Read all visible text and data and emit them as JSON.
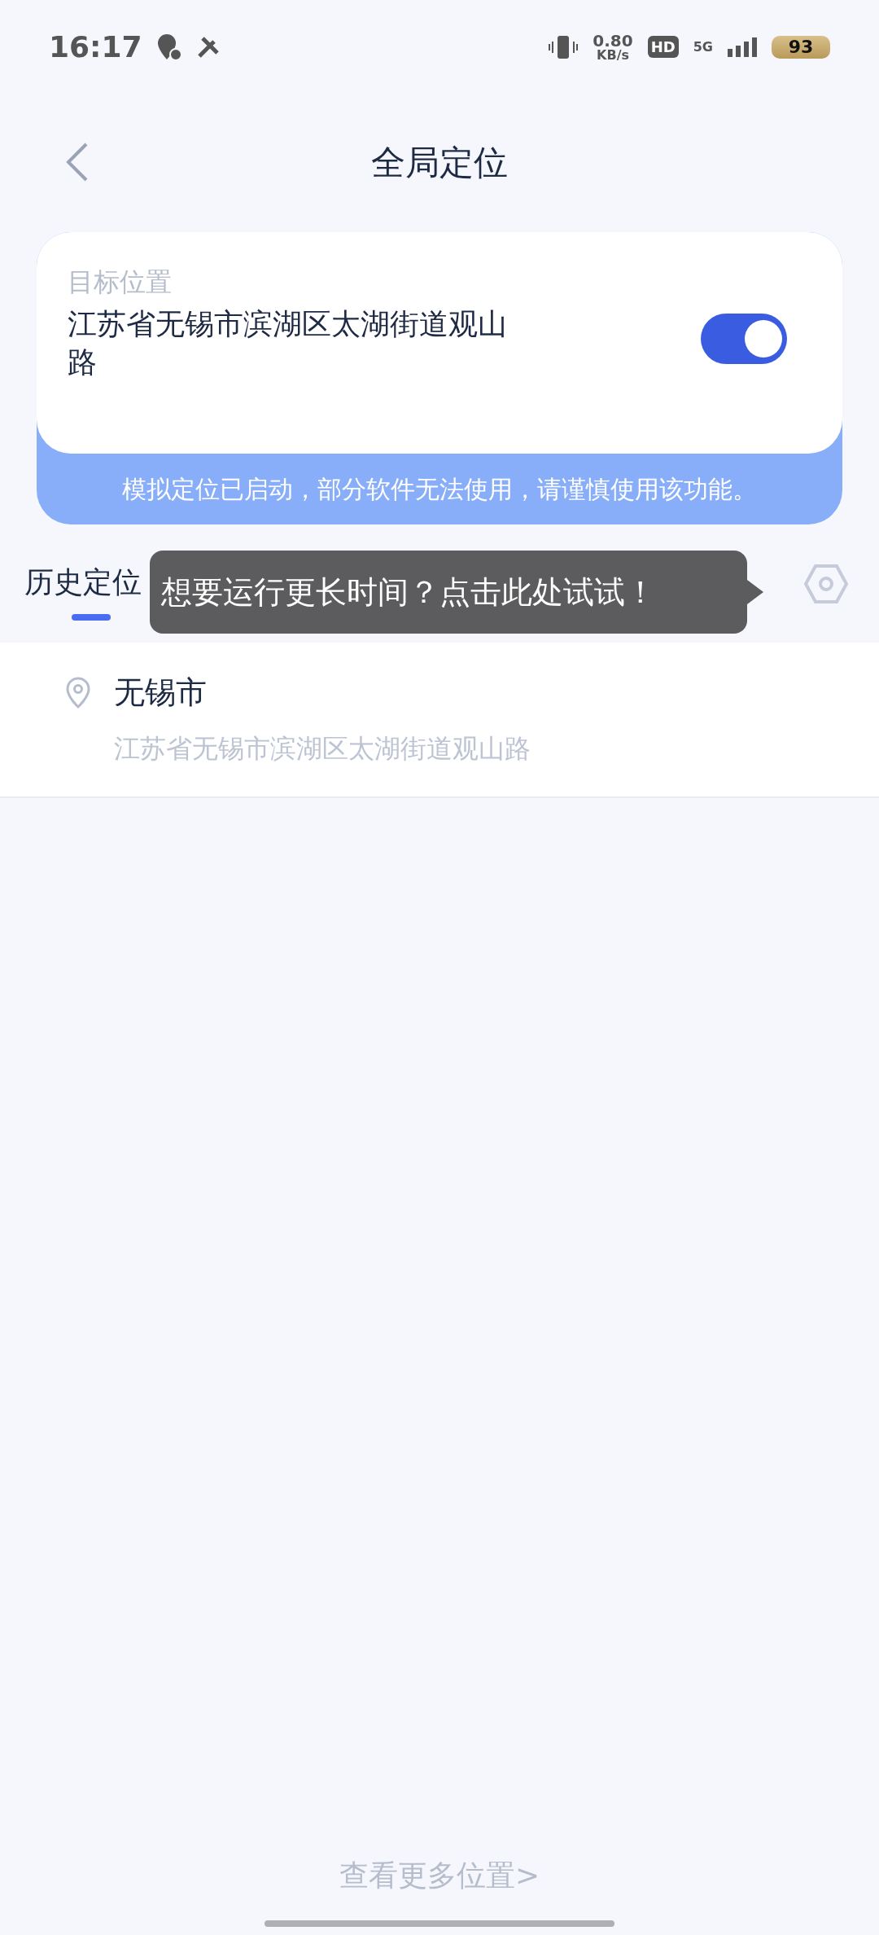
{
  "status_bar": {
    "time": "16:17",
    "speed_value": "0.80",
    "speed_unit": "KB/s",
    "hd": "HD",
    "network": "5G",
    "battery": "93"
  },
  "header": {
    "title": "全局定位"
  },
  "target": {
    "label": "目标位置",
    "address": "江苏省无锡市滨湖区太湖街道观山路",
    "on": true,
    "notice": "模拟定位已启动，部分软件无法使用，请谨慎使用该功能。"
  },
  "tabs": [
    {
      "label": "历史定位",
      "selected": true
    }
  ],
  "tooltip": {
    "text": "想要运行更长时间？点击此处试试！"
  },
  "history": [
    {
      "name": "无锡市",
      "address": "江苏省无锡市滨湖区太湖街道观山路"
    }
  ],
  "footer": {
    "link": "查看更多位置>"
  }
}
